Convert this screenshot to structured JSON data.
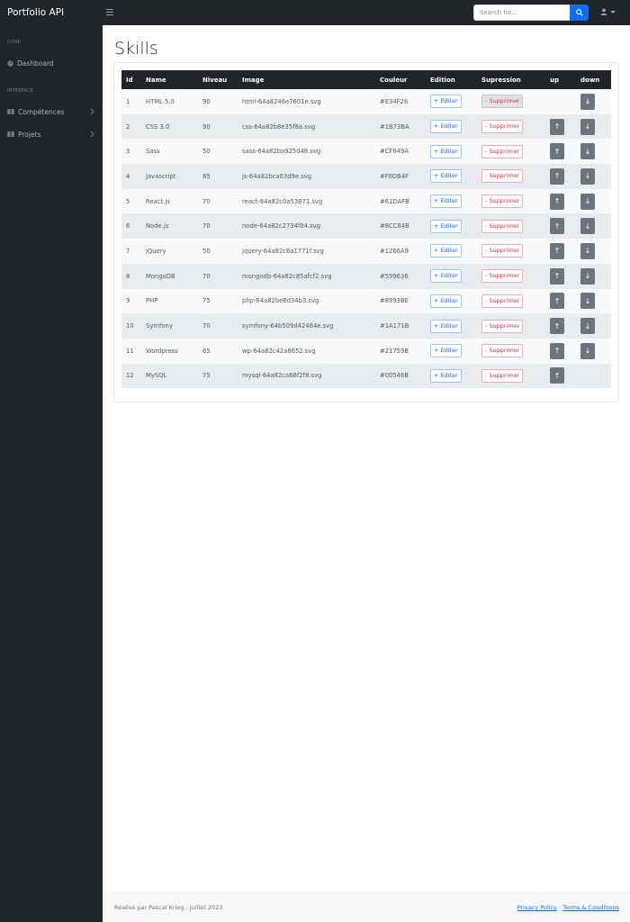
{
  "navbar": {
    "brand": "Portfolio API",
    "toggle_icon": "menu-icon",
    "search_placeholder": "Search for...",
    "search_value": "",
    "search_icon": "search-icon",
    "user_icon": "user-icon"
  },
  "sidebar": {
    "sections": [
      {
        "heading": "CORE",
        "items": [
          {
            "label": "Dashboard",
            "icon": "speedometer-icon"
          }
        ]
      },
      {
        "heading": "INTERFACE",
        "items": [
          {
            "label": "Compétences",
            "icon": "columns-icon"
          },
          {
            "label": "Projets",
            "icon": "columns-icon"
          }
        ]
      }
    ]
  },
  "page": {
    "title": "Skills"
  },
  "table": {
    "headers": [
      "Id",
      "Name",
      "Niveau",
      "Image",
      "Couleur",
      "Edition",
      "Supression",
      "up",
      "down"
    ],
    "edit_label": "+ Editer",
    "delete_label": "- Supprimer",
    "up_label": "↑",
    "down_label": "↓",
    "rows": [
      {
        "id": "1",
        "name": "HTML 5.0",
        "niveau": "90",
        "image": "html-64a8246e7601e.svg",
        "couleur": "#E34F26"
      },
      {
        "id": "2",
        "name": "CSS 3.0",
        "niveau": "90",
        "image": "css-64a82b8e35f8a.svg",
        "couleur": "#1B73BA"
      },
      {
        "id": "3",
        "name": "Sass",
        "niveau": "50",
        "image": "sass-64a82ba925d48.svg",
        "couleur": "#CF649A"
      },
      {
        "id": "4",
        "name": "Javascript",
        "niveau": "85",
        "image": "js-64a82bca03d9e.svg",
        "couleur": "#F0DB4F"
      },
      {
        "id": "5",
        "name": "React.js",
        "niveau": "70",
        "image": "react-64a82c0a53871.svg",
        "couleur": "#61DAFB"
      },
      {
        "id": "6",
        "name": "Node.js",
        "niveau": "70",
        "image": "node-64a82c2734f04.svg",
        "couleur": "#8CC84B"
      },
      {
        "id": "7",
        "name": "jQuery",
        "niveau": "50",
        "image": "jquery-64a82c6a1771f.svg",
        "couleur": "#1266A9"
      },
      {
        "id": "8",
        "name": "MongoDB",
        "niveau": "70",
        "image": "mongodb-64a82c85afcf2.svg",
        "couleur": "#599636"
      },
      {
        "id": "9",
        "name": "PHP",
        "niveau": "75",
        "image": "php-64a82be8d34b3.svg",
        "couleur": "#8993BE"
      },
      {
        "id": "10",
        "name": "Symfony",
        "niveau": "70",
        "image": "symfony-64b509d42464e.svg",
        "couleur": "#1A171B"
      },
      {
        "id": "11",
        "name": "Wordpress",
        "niveau": "65",
        "image": "wp-64a82c42a8652.svg",
        "couleur": "#21759B"
      },
      {
        "id": "12",
        "name": "MySQL",
        "niveau": "75",
        "image": "mysql-64a82ca66f2f8.svg",
        "couleur": "#00546B"
      }
    ]
  },
  "footer": {
    "credit": "Réalisé par Pascal Krieg - juillet 2023",
    "privacy": "Privacy Policy",
    "separator": "·",
    "terms": "Terms & Conditions"
  }
}
